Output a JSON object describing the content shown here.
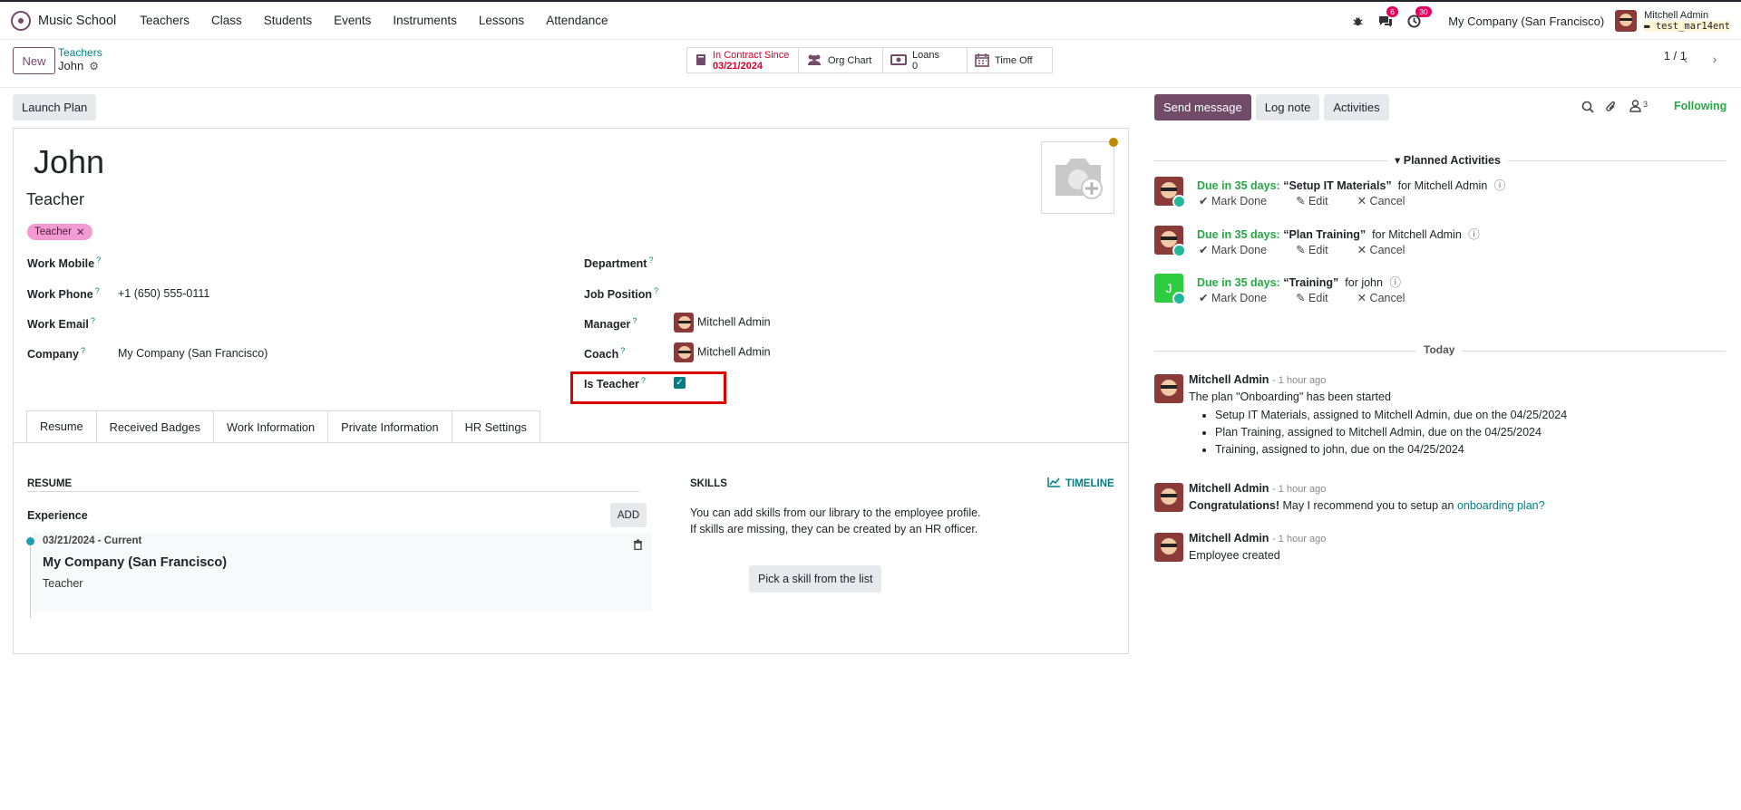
{
  "topbar": {
    "app_name": "Music School",
    "menu": [
      "Teachers",
      "Class",
      "Students",
      "Events",
      "Instruments",
      "Lessons",
      "Attendance"
    ],
    "messages_count": "6",
    "activities_count": "30",
    "company": "My Company (San Francisco)",
    "user_name": "Mitchell Admin",
    "db_name": "test_mar14ent"
  },
  "control": {
    "new_label": "New",
    "breadcrumb_parent": "Teachers",
    "breadcrumb_current": "John",
    "smart_contract_label": "In Contract Since",
    "smart_contract_date": "03/21/2024",
    "smart_org": "Org Chart",
    "smart_loans_label": "Loans",
    "smart_loans_count": "0",
    "smart_timeoff": "Time Off",
    "pager": "1 / 1"
  },
  "form": {
    "launch_plan": "Launch Plan",
    "name": "John",
    "job_title": "Teacher",
    "tag": "Teacher",
    "fields": {
      "work_mobile_label": "Work Mobile",
      "work_mobile_value": "",
      "work_phone_label": "Work Phone",
      "work_phone_value": "+1 (650) 555-0111",
      "work_email_label": "Work Email",
      "company_label": "Company",
      "company_value": "My Company (San Francisco)",
      "department_label": "Department",
      "job_position_label": "Job Position",
      "manager_label": "Manager",
      "manager_value": "Mitchell Admin",
      "coach_label": "Coach",
      "coach_value": "Mitchell Admin",
      "is_teacher_label": "Is Teacher",
      "is_teacher_value": true,
      "help_marker": "?"
    },
    "tabs": [
      "Resume",
      "Received Badges",
      "Work Information",
      "Private Information",
      "HR Settings"
    ],
    "resume": {
      "heading": "RESUME",
      "experience_label": "Experience",
      "add_label": "ADD",
      "entry_dates": "03/21/2024 - Current",
      "entry_company": "My Company (San Francisco)",
      "entry_role": "Teacher"
    },
    "skills": {
      "heading": "SKILLS",
      "timeline_label": "TIMELINE",
      "text_line1": "You can add skills from our library to the employee profile.",
      "text_line2": "If skills are missing, they can be created by an HR officer.",
      "pick_label": "Pick a skill from the list"
    }
  },
  "chatter": {
    "send_message": "Send message",
    "log_note": "Log note",
    "activities": "Activities",
    "followers_count": "3",
    "following": "Following",
    "planned_heading": "Planned Activities",
    "planned": [
      {
        "due": "Due in 35 days:",
        "title": "“Setup IT Materials”",
        "for": "for Mitchell Admin",
        "avatar": "face"
      },
      {
        "due": "Due in 35 days:",
        "title": "“Plan Training”",
        "for": "for Mitchell Admin",
        "avatar": "face"
      },
      {
        "due": "Due in 35 days:",
        "title": "“Training”",
        "for": "for john",
        "avatar": "J"
      }
    ],
    "mark_done": "Mark Done",
    "edit": "Edit",
    "cancel": "Cancel",
    "today": "Today",
    "messages": [
      {
        "author": "Mitchell Admin",
        "time": "- 1 hour ago",
        "body": "The plan \"Onboarding\" has been started",
        "bullets": [
          "Setup IT Materials, assigned to Mitchell Admin, due on the 04/25/2024",
          "Plan Training, assigned to Mitchell Admin, due on the 04/25/2024",
          "Training, assigned to john, due on the 04/25/2024"
        ]
      },
      {
        "author": "Mitchell Admin",
        "time": "- 1 hour ago",
        "body_bold": "Congratulations!",
        "body": " May I recommend you to setup an ",
        "link": "onboarding plan?"
      },
      {
        "author": "Mitchell Admin",
        "time": "- 1 hour ago",
        "body": "Employee created"
      }
    ]
  },
  "colors": {
    "brand": "#714B67",
    "teal": "#017e84",
    "badge": "#e4005c",
    "highlight": "#e00000",
    "due": "#28a745"
  }
}
